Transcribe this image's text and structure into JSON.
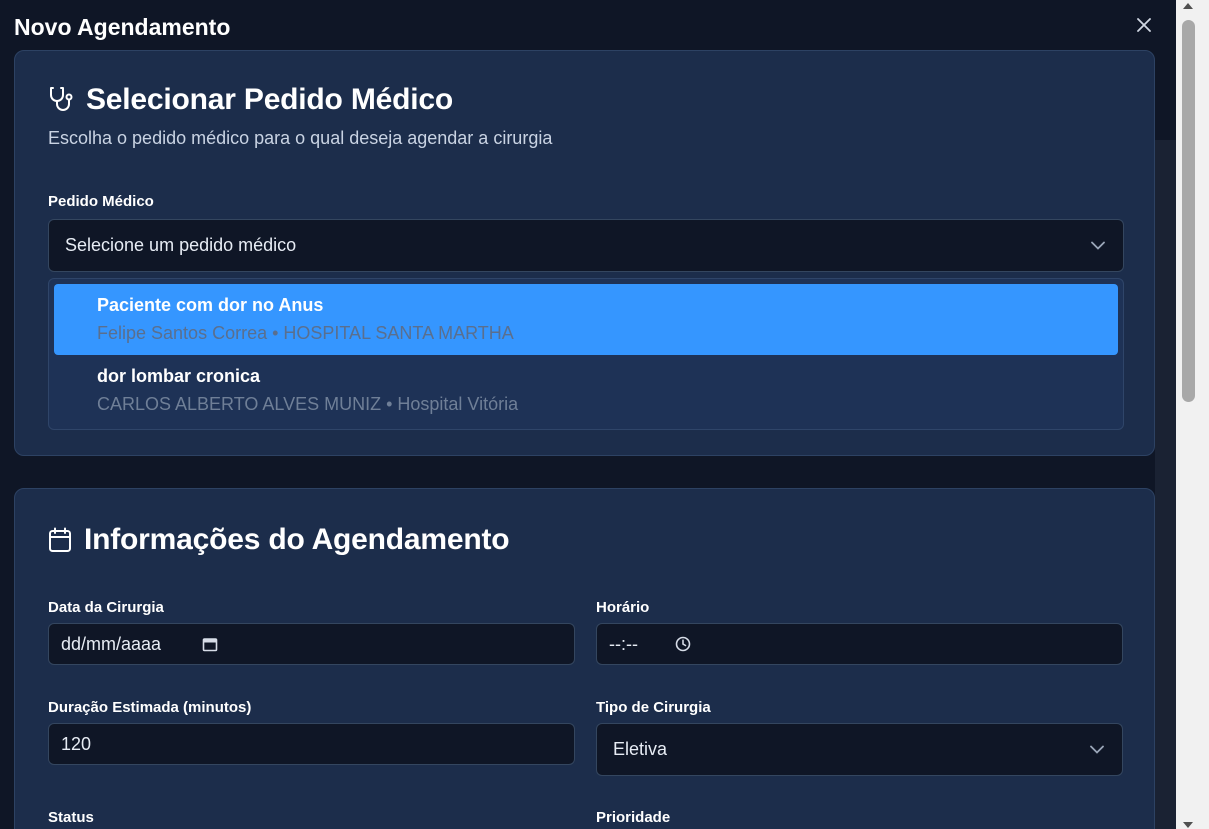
{
  "modal": {
    "title": "Novo Agendamento",
    "close_icon": "close-icon"
  },
  "section_order": {
    "icon": "stethoscope-icon",
    "title": "Selecionar Pedido Médico",
    "subtitle": "Escolha o pedido médico para o qual deseja agendar a cirurgia",
    "field_label": "Pedido Médico",
    "select_placeholder": "Selecione um pedido médico",
    "options": [
      {
        "title": "Paciente com dor no Anus",
        "subtitle": "Felipe Santos Correa • HOSPITAL SANTA MARTHA",
        "highlighted": true
      },
      {
        "title": "dor lombar cronica",
        "subtitle": "CARLOS ALBERTO ALVES MUNIZ • Hospital Vitória",
        "highlighted": false
      }
    ]
  },
  "section_schedule": {
    "icon": "calendar-icon",
    "title": "Informações do Agendamento",
    "date_label": "Data da Cirurgia",
    "date_value": "dd/mm/aaaa",
    "time_label": "Horário",
    "time_value": "--:--",
    "duration_label": "Duração Estimada (minutos)",
    "duration_value": "120",
    "type_label": "Tipo de Cirurgia",
    "type_value": "Eletiva",
    "status_label": "Status",
    "priority_label": "Prioridade"
  },
  "colors": {
    "background": "#0f1626",
    "card": "#1c2d4b",
    "highlight": "#3596ff",
    "input_bg": "#0f1626"
  }
}
